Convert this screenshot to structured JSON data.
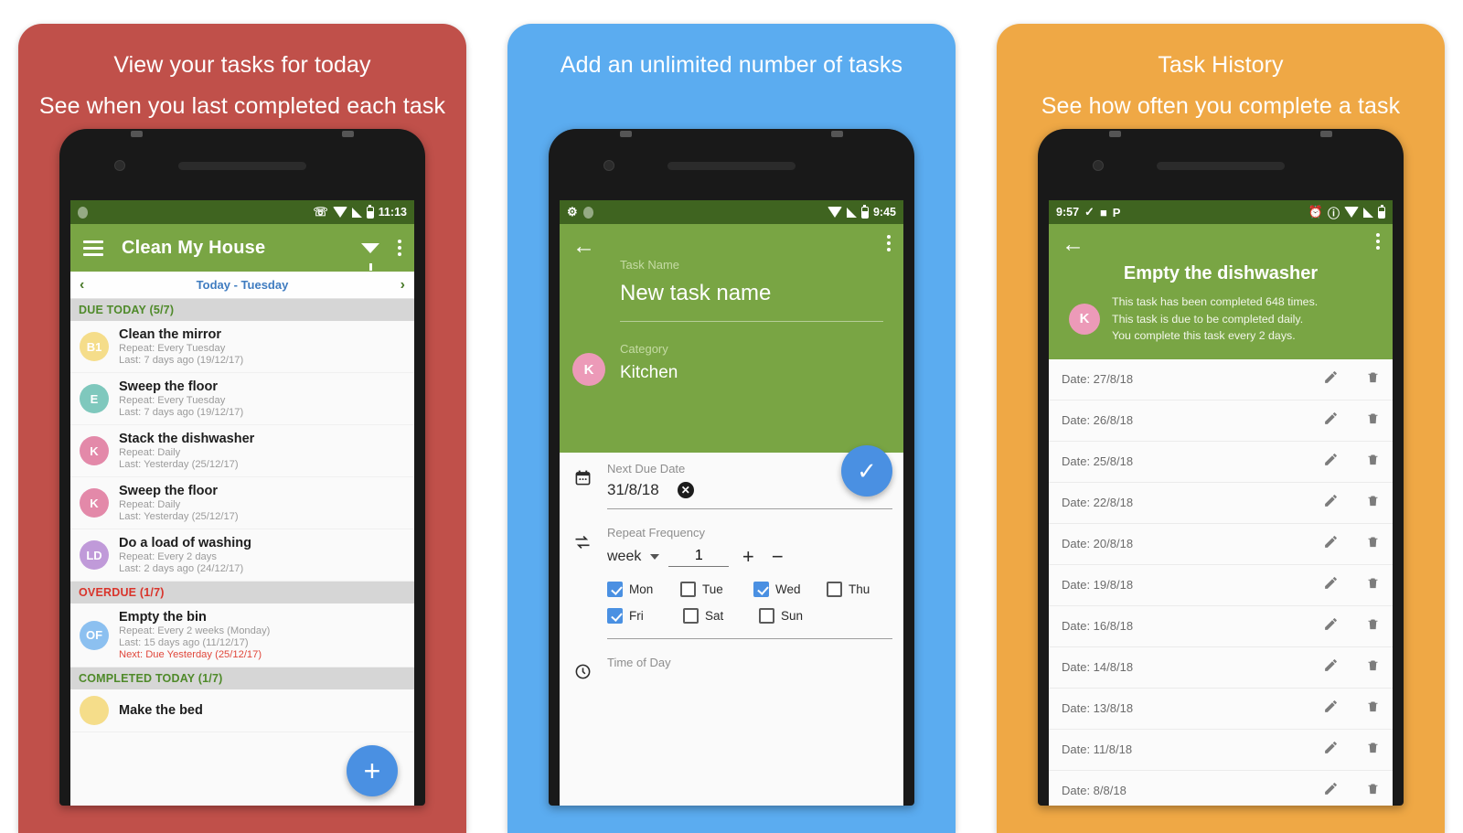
{
  "panels": [
    {
      "id": "panel-today",
      "bg_color": "#c0504a",
      "title": "View your tasks for today",
      "subtitle": "See when you last completed each task"
    },
    {
      "id": "panel-add",
      "bg_color": "#5bacf0",
      "title": "Add an unlimited number of tasks",
      "subtitle": ""
    },
    {
      "id": "panel-history",
      "bg_color": "#efa845",
      "title": "Task History",
      "subtitle": "See how often you complete a task"
    }
  ],
  "phone1": {
    "statusbar": {
      "time": "11:13",
      "icons": [
        "sim-icon",
        "wifi-icon",
        "signal-icon",
        "battery-icon"
      ]
    },
    "appbar": {
      "title": "Clean My House",
      "menu_icon": "hamburger-icon",
      "filter_icon": "funnel-icon",
      "overflow_icon": "kebab-icon"
    },
    "datenav": {
      "prev": "‹",
      "label": "Today - Tuesday",
      "next": "›"
    },
    "sections": [
      {
        "header": "DUE TODAY (5/7)",
        "type": "due",
        "tasks": [
          {
            "avatar": "B1",
            "color": "#f5dd8a",
            "name": "Clean the mirror",
            "repeat": "Repeat: Every Tuesday",
            "last": "Last: 7 days ago (19/12/17)"
          },
          {
            "avatar": "E",
            "color": "#7fc8bd",
            "name": "Sweep the floor",
            "repeat": "Repeat: Every Tuesday",
            "last": "Last: 7 days ago (19/12/17)"
          },
          {
            "avatar": "K",
            "color": "#e389a9",
            "name": "Stack the dishwasher",
            "repeat": "Repeat: Daily",
            "last": "Last: Yesterday (25/12/17)"
          },
          {
            "avatar": "K",
            "color": "#e389a9",
            "name": "Sweep the floor",
            "repeat": "Repeat: Daily",
            "last": "Last: Yesterday (25/12/17)"
          },
          {
            "avatar": "LD",
            "color": "#c09ad9",
            "name": "Do a load of washing",
            "repeat": "Repeat: Every 2 days",
            "last": "Last: 2 days ago (24/12/17)"
          }
        ]
      },
      {
        "header": "OVERDUE (1/7)",
        "type": "overdue",
        "tasks": [
          {
            "avatar": "OF",
            "color": "#8cc0f0",
            "name": "Empty the bin",
            "repeat": "Repeat: Every 2 weeks (Monday)",
            "last": "Last: 15 days ago (11/12/17)",
            "next": "Next: Due Yesterday (25/12/17)"
          }
        ]
      },
      {
        "header": "COMPLETED TODAY (1/7)",
        "type": "completed",
        "tasks": [
          {
            "avatar": "",
            "color": "#f5dd8a",
            "name": "Make the bed",
            "repeat": "",
            "last": ""
          }
        ]
      }
    ],
    "fab": {
      "icon": "plus-icon",
      "label": "+"
    }
  },
  "phone2": {
    "statusbar": {
      "time": "9:45",
      "icons": [
        "gear-icon",
        "dot-icon",
        "wifi-icon",
        "signal-icon",
        "battery-icon"
      ]
    },
    "appbar": {
      "back_icon": "back-arrow-icon",
      "overflow_icon": "kebab-icon"
    },
    "task_name": {
      "label": "Task Name",
      "value": "New task name"
    },
    "category": {
      "label": "Category",
      "value": "Kitchen",
      "avatar": "K",
      "avatar_color": "#ec9ab8"
    },
    "next_due_date": {
      "label": "Next Due Date",
      "value": "31/8/18",
      "icon": "calendar-icon",
      "clear_icon": "clear-icon"
    },
    "repeat_frequency": {
      "label": "Repeat Frequency",
      "icon": "repeat-icon",
      "unit": "week",
      "count": "1",
      "plus": "+",
      "minus": "−",
      "days": [
        {
          "label": "Mon",
          "checked": true
        },
        {
          "label": "Tue",
          "checked": false
        },
        {
          "label": "Wed",
          "checked": true
        },
        {
          "label": "Thu",
          "checked": false
        },
        {
          "label": "Fri",
          "checked": true
        },
        {
          "label": "Sat",
          "checked": false
        },
        {
          "label": "Sun",
          "checked": false
        }
      ]
    },
    "time_of_day": {
      "label": "Time of Day",
      "icon": "clock-icon"
    },
    "fab": {
      "icon": "check-icon",
      "label": "✓"
    }
  },
  "phone3": {
    "statusbar": {
      "time": "9:57",
      "left_icons": [
        "check-circle-icon",
        "square-icon",
        "p-icon"
      ],
      "right_icons": [
        "alarm-icon",
        "info-icon",
        "wifi-icon",
        "signal-icon",
        "battery-icon"
      ]
    },
    "appbar": {
      "back_icon": "back-arrow-icon",
      "overflow_icon": "kebab-icon"
    },
    "title": "Empty the dishwasher",
    "avatar": "K",
    "avatar_color": "#ec9ab8",
    "info_lines": [
      "This task has been completed 648 times.",
      "This task is due to be completed daily.",
      "You complete this task every 2 days."
    ],
    "rows": [
      {
        "date": "Date: 27/8/18"
      },
      {
        "date": "Date: 26/8/18"
      },
      {
        "date": "Date: 25/8/18"
      },
      {
        "date": "Date: 22/8/18"
      },
      {
        "date": "Date: 20/8/18"
      },
      {
        "date": "Date: 19/8/18"
      },
      {
        "date": "Date: 16/8/18"
      },
      {
        "date": "Date: 14/8/18"
      },
      {
        "date": "Date: 13/8/18"
      },
      {
        "date": "Date: 11/8/18"
      },
      {
        "date": "Date: 8/8/18"
      }
    ],
    "row_actions": {
      "edit_icon": "pencil-icon",
      "delete_icon": "trash-icon"
    }
  }
}
